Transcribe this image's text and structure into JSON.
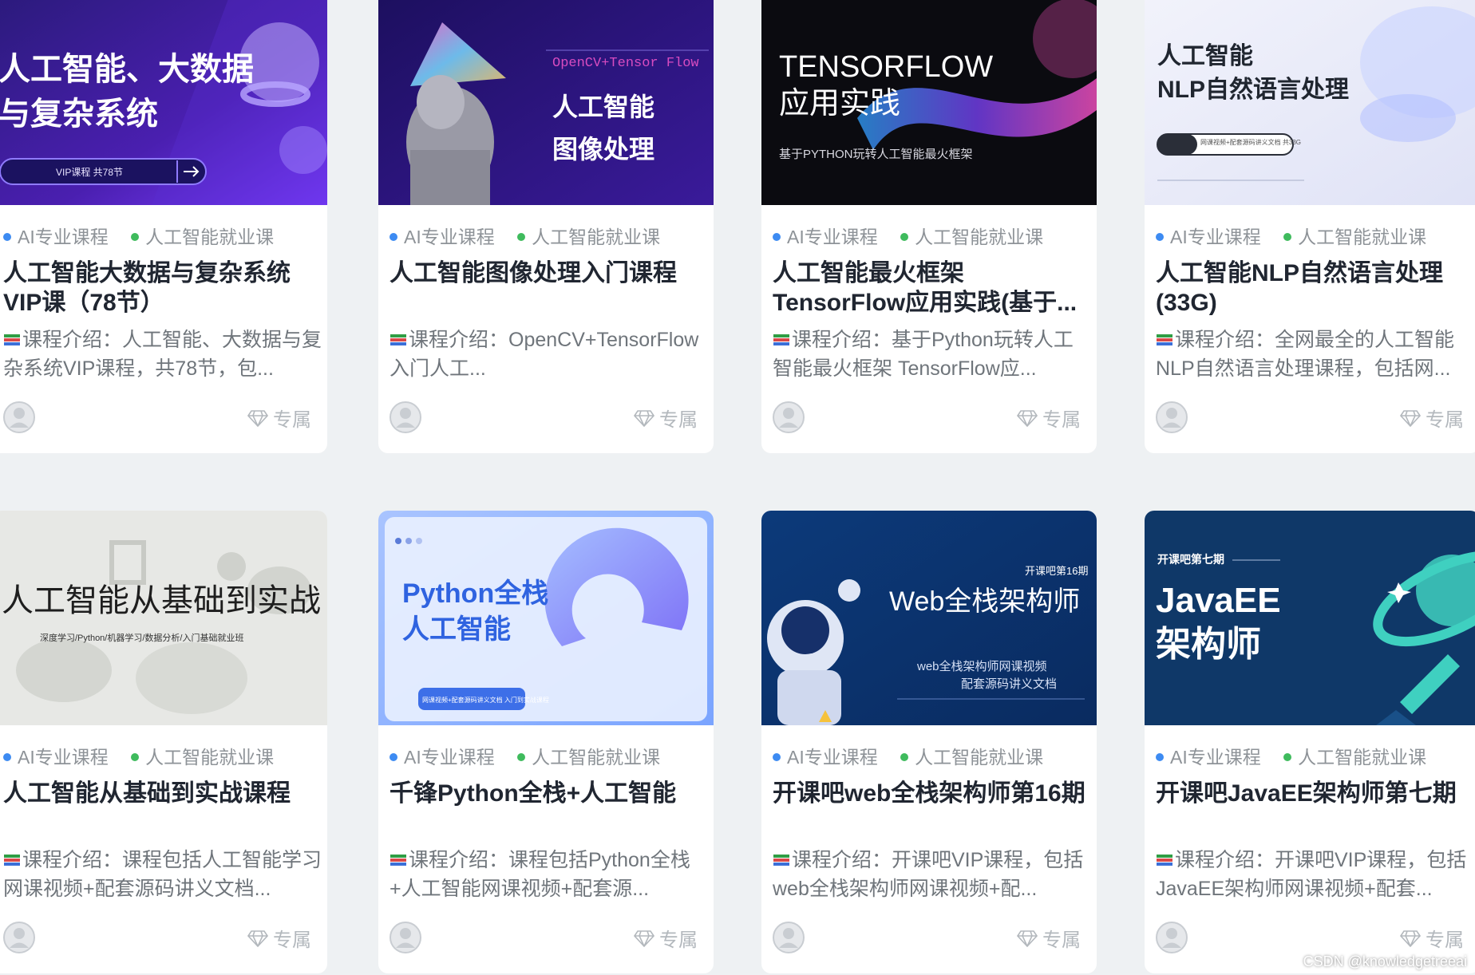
{
  "colors": {
    "page_bg": "#eef1f3",
    "tag_dot_1": "#3d8bf2",
    "tag_dot_2": "#3fbb5d"
  },
  "courses": [
    {
      "thumb": {
        "lines": [
          "人工智能、大数据",
          "与复杂系统"
        ],
        "pill": "VIP课程 共78节"
      },
      "tags": [
        "AI专业课程",
        "人工智能就业课"
      ],
      "title": "人工智能大数据与复杂系统VIP课（78节）",
      "desc": "课程介绍：人工智能、大数据与复杂系统VIP课程，共78节，包...",
      "badge": "专属"
    },
    {
      "thumb": {
        "sub": "OpenCV+Tensor Flow",
        "lines": [
          "人工智能",
          "图像处理"
        ]
      },
      "tags": [
        "AI专业课程",
        "人工智能就业课"
      ],
      "title": "人工智能图像处理入门课程",
      "desc": "课程介绍：OpenCV+TensorFlow 入门人工...",
      "badge": "专属"
    },
    {
      "thumb": {
        "lines": [
          "TENSORFLOW",
          "应用实践"
        ],
        "sub": "基于PYTHON玩转人工智能最火框架"
      },
      "tags": [
        "AI专业课程",
        "人工智能就业课"
      ],
      "title": "人工智能最火框架TensorFlow应用实践(基于...",
      "desc": "课程介绍：基于Python玩转人工智能最火框架 TensorFlow应...",
      "badge": "专属"
    },
    {
      "thumb": {
        "lines": [
          "人工智能",
          "NLP自然语言处理"
        ],
        "pill": "网课视频+配套源码讲义文档 共33G"
      },
      "tags": [
        "AI专业课程",
        "人工智能就业课"
      ],
      "title": "人工智能NLP自然语言处理(33G)",
      "desc": "课程介绍：全网最全的人工智能NLP自然语言处理课程，包括网...",
      "badge": "专属"
    },
    {
      "thumb": {
        "lines": [
          "人工智能从基础到实战"
        ],
        "sub": "深度学习/Python/机器学习/数据分析/入门基础就业班"
      },
      "tags": [
        "AI专业课程",
        "人工智能就业课"
      ],
      "title": "人工智能从基础到实战课程",
      "desc": "课程介绍：课程包括人工智能学习网课视频+配套源码讲义文档...",
      "badge": "专属"
    },
    {
      "thumb": {
        "lines": [
          "Python全栈",
          "人工智能"
        ],
        "pill": "网课视频+配套源码讲义文档 入门到实战课程"
      },
      "tags": [
        "AI专业课程",
        "人工智能就业课"
      ],
      "title": "千锋Python全栈+人工智能",
      "desc": "课程介绍：课程包括Python全栈+人工智能网课视频+配套源...",
      "badge": "专属"
    },
    {
      "thumb": {
        "top": "开课吧第16期",
        "lines": [
          "Web全栈架构师"
        ],
        "sub": "web全栈架构师网课视频",
        "sub2": "配套源码讲义文档"
      },
      "tags": [
        "AI专业课程",
        "人工智能就业课"
      ],
      "title": "开课吧web全栈架构师第16期",
      "desc": "课程介绍：开课吧VIP课程，包括web全栈架构师网课视频+配...",
      "badge": "专属"
    },
    {
      "thumb": {
        "top": "开课吧第七期",
        "lines": [
          "JavaEE",
          "架构师"
        ]
      },
      "tags": [
        "AI专业课程",
        "人工智能就业课"
      ],
      "title": "开课吧JavaEE架构师第七期",
      "desc": "课程介绍：开课吧VIP课程，包括JavaEE架构师网课视频+配套...",
      "badge": "专属"
    }
  ],
  "watermark": "CSDN @knowledgetreeai"
}
